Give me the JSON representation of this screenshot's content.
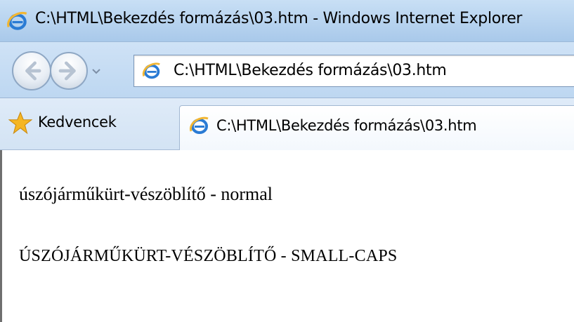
{
  "window": {
    "title": "C:\\HTML\\Bekezdés formázás\\03.htm - Windows Internet Explorer",
    "icon": "ie-icon"
  },
  "navigation": {
    "back_icon": "back-arrow-icon",
    "forward_icon": "forward-arrow-icon",
    "dropdown_icon": "chevron-down-icon",
    "address": "C:\\HTML\\Bekezdés formázás\\03.htm"
  },
  "tabbar": {
    "favorites_label": "Kedvencek",
    "favorites_icon": "star-icon",
    "active_tab_label": "C:\\HTML\\Bekezdés formázás\\03.htm"
  },
  "page": {
    "paragraphs": [
      {
        "text": "úszójárműkürt-vészöblítő - normal",
        "variant": "normal"
      },
      {
        "text": "ÚSZÓJÁRMŰKÜRT-VÉSZÖBLÍTŐ - SMALL-CAPS",
        "variant": "small-caps"
      }
    ]
  },
  "colors": {
    "chrome_blue": "#bdd7f1",
    "ie_icon_blue": "#2a7bd4",
    "star_gold": "#f5b623"
  }
}
